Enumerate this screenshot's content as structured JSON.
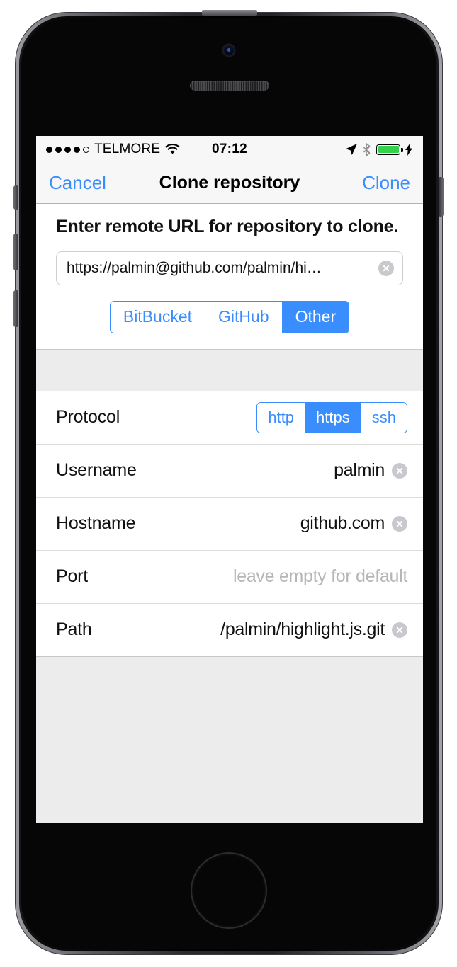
{
  "status_bar": {
    "signal_dots_filled": 4,
    "signal_dots_total": 5,
    "carrier": "TELMORE",
    "wifi_icon": "wifi-icon",
    "time": "07:12",
    "location_icon": "location-arrow-icon",
    "bluetooth_icon": "bluetooth-icon",
    "battery_icon": "battery-full-icon",
    "battery_color": "#34d24a",
    "charging_icon": "lightning-bolt-icon"
  },
  "nav_bar": {
    "cancel_label": "Cancel",
    "title": "Clone repository",
    "clone_label": "Clone",
    "accent_color": "#3a8dfd"
  },
  "header": {
    "instruction": "Enter remote URL for repository to clone."
  },
  "url_field": {
    "value": "https://palmin@github.com/palmin/hi…",
    "clear_icon": "clear-circle-icon"
  },
  "host_segmented": {
    "options": [
      "BitBucket",
      "GitHub",
      "Other"
    ],
    "selected": "Other"
  },
  "form": {
    "protocol": {
      "label": "Protocol",
      "options": [
        "http",
        "https",
        "ssh"
      ],
      "selected": "https"
    },
    "rows": [
      {
        "label": "Username",
        "value": "palmin",
        "placeholder": "",
        "has_clear": true
      },
      {
        "label": "Hostname",
        "value": "github.com",
        "placeholder": "",
        "has_clear": true
      },
      {
        "label": "Port",
        "value": "",
        "placeholder": "leave empty for default",
        "has_clear": false
      },
      {
        "label": "Path",
        "value": "/palmin/highlight.js.git",
        "placeholder": "",
        "has_clear": true
      }
    ]
  }
}
